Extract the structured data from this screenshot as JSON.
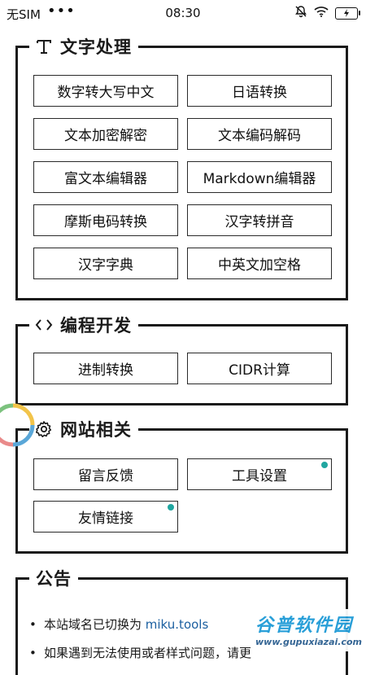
{
  "status_bar": {
    "carrier": "无SIM",
    "dots": "•••",
    "time": "08:30",
    "battery_icon": "battery-charging-icon"
  },
  "sections": {
    "text": {
      "title": "文字处理",
      "icon": "text-icon",
      "buttons": [
        "数字转大写中文",
        "日语转换",
        "文本加密解密",
        "文本编码解码",
        "富文本编辑器",
        "Markdown编辑器",
        "摩斯电码转换",
        "汉字转拼音",
        "汉字字典",
        "中英文加空格"
      ]
    },
    "dev": {
      "title": "编程开发",
      "icon": "code-icon",
      "buttons": [
        "进制转换",
        "CIDR计算"
      ]
    },
    "site": {
      "title": "网站相关",
      "icon": "gear-icon",
      "buttons": [
        "留言反馈",
        "工具设置",
        "友情链接"
      ],
      "badge_color": "#20a6a0"
    },
    "notice": {
      "title": "公告",
      "items": [
        {
          "text": "本站域名已切换为 ",
          "link": "miku.tools"
        },
        {
          "text": "如果遇到无法使用或者样式问题，请更",
          "link": ""
        }
      ]
    }
  },
  "watermark": {
    "logo": "谷普软件园",
    "url": "www.gupuxiazai.com"
  }
}
